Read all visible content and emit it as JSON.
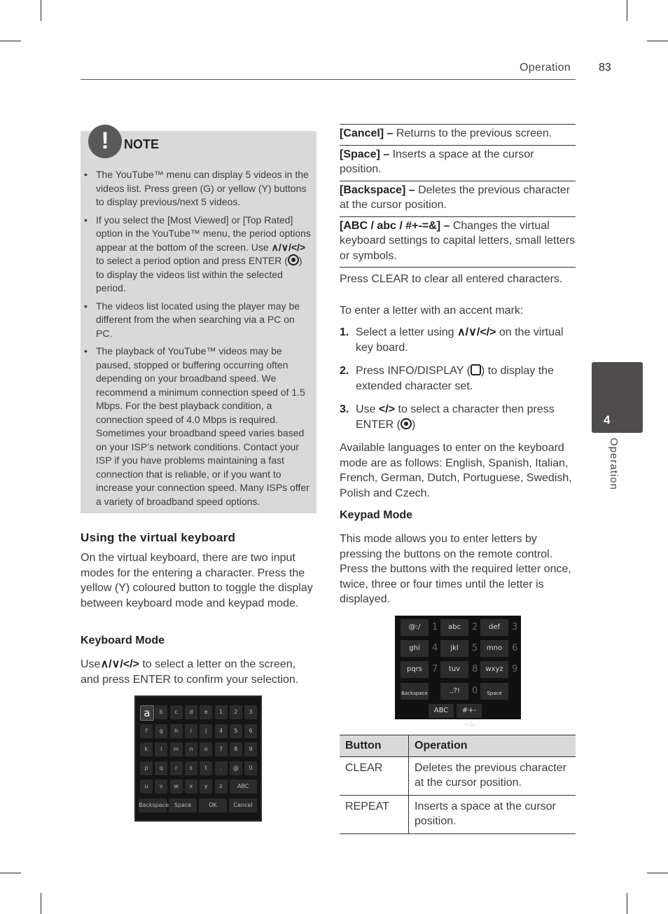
{
  "header": {
    "section": "Operation",
    "page_number": "83"
  },
  "side_tab": {
    "chapter_number": "4",
    "label": "Operation"
  },
  "note": {
    "title": "NOTE",
    "items": [
      "The YouTube™ menu can display 5 videos in the videos list. Press green (G) or yellow (Y) buttons to display previous/next 5 videos.",
      "If you select the [Most Viewed] or [Top Rated] option in the YouTube™ menu, the period options appear at the bottom of the screen. Use",
      "The videos list located using the player may be different from the when searching via a PC on PC.",
      "The playback of YouTube™ videos may be paused, stopped or buffering occurring often depending on your broadband speed. We recommend a minimum connection speed of 1.5 Mbps. For the best playback condition, a connection speed of 4.0 Mbps is required. Sometimes your broadband speed varies based on your ISP’s network conditions. Contact your ISP if you have problems maintaining a fast connection that is reliable, or if you want to increase your connection speed. Many ISPs offer a variety of broadband speed options."
    ],
    "item2_arrows": "∧/∨/</>",
    "item2_mid": " to select a period option and press ENTER (",
    "item2_end": ") to display the videos list within the selected period."
  },
  "left": {
    "section_title": "Using the virtual keyboard",
    "intro": "On the virtual keyboard, there are two input modes for the entering a character. Press the yellow (Y) coloured button to toggle the display between keyboard mode and keypad mode.",
    "keyboard_mode_title": "Keyboard Mode",
    "keyboard_mode_prefix": "Use",
    "keyboard_mode_arrows": "∧/∨/</>",
    "keyboard_mode_text": " to select a letter on the screen, and press ENTER to confirm your selection."
  },
  "keyboard_image": {
    "rows": [
      [
        "a",
        "b",
        "c",
        "d",
        "e",
        "1",
        "2",
        "3"
      ],
      [
        "f",
        "g",
        "h",
        "i",
        "j",
        "4",
        "5",
        "6"
      ],
      [
        "k",
        "l",
        "m",
        "n",
        "o",
        "7",
        "8",
        "9"
      ],
      [
        "p",
        "q",
        "r",
        "s",
        "t",
        ".",
        "@",
        "0"
      ],
      [
        "u",
        "v",
        "w",
        "x",
        "y",
        "z",
        "ABC"
      ]
    ],
    "bottom_row": [
      "Backspace",
      "Space",
      "OK",
      "Cancel"
    ]
  },
  "definitions": [
    {
      "term": "[Cancel] –",
      "desc": " Returns to the previous screen."
    },
    {
      "term": "[Space] –",
      "desc": " Inserts a space at the cursor position."
    },
    {
      "term": "[Backspace] –",
      "desc": " Deletes the previous character at the cursor position."
    },
    {
      "term": "[ABC / abc / #+-=&] –",
      "desc": " Changes the virtual keyboard settings to capital letters, small letters or symbols."
    }
  ],
  "right": {
    "clear_text": "Press CLEAR to clear all entered characters.",
    "accent_intro": "To enter a letter with an accent mark:",
    "steps": [
      {
        "n": "1.",
        "a": "Select a letter using ",
        "arrows": "∧/∨/</>",
        "b": " on the virtual key board."
      },
      {
        "n": "2.",
        "a": "Press INFO/DISPLAY (",
        "b": ") to display the extended character set."
      },
      {
        "n": "3.",
        "a": "Use ",
        "arrows": "</>",
        "b": " to select a character then press ENTER (",
        "c": ")"
      }
    ],
    "languages": "Available languages to enter on the keyboard mode are as follows: English, Spanish, Italian, French, German, Dutch, Portuguese, Swedish, Polish and Czech.",
    "keypad_mode_title": "Keypad Mode",
    "keypad_mode_text": "This mode allows you to enter letters by pressing the buttons on the remote control. Press the buttons with the required letter once, twice, three or four times until the letter is displayed."
  },
  "keypad_image": {
    "keys": [
      "@:/",
      "abc",
      "def",
      "ghi",
      "jkl",
      "mno",
      "pqrs",
      "tuv",
      "wxyz",
      "Backspace",
      ".,?!",
      "Space"
    ],
    "numbers": [
      "1",
      "2",
      "3",
      "4",
      "5",
      "6",
      "7",
      "8",
      "9",
      "0"
    ],
    "bottom": [
      "ABC",
      "#+-=&"
    ]
  },
  "table": {
    "headers": [
      "Button",
      "Operation"
    ],
    "rows": [
      [
        "CLEAR",
        "Deletes the previous character at the cursor position."
      ],
      [
        "REPEAT",
        "Inserts a space at the cursor position."
      ]
    ]
  }
}
